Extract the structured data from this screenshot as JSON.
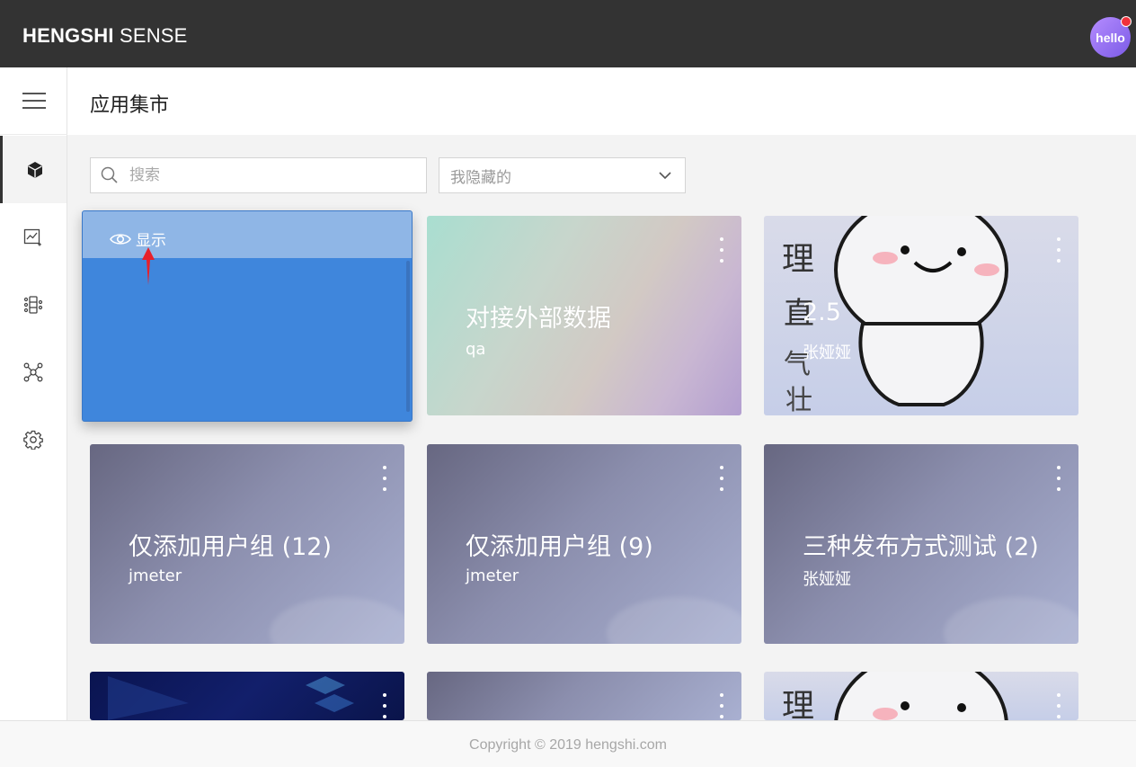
{
  "header": {
    "brand_bold": "HENGSHI",
    "brand_rest": " SENSE",
    "avatar_text": "hello",
    "notification_color": "#f0323c"
  },
  "sidebar": {
    "menu_icon": "hamburger-icon",
    "items": [
      {
        "icon": "cube-icon",
        "active": true
      },
      {
        "icon": "line-chart-icon",
        "active": false
      },
      {
        "icon": "dataset-icon",
        "active": false
      },
      {
        "icon": "network-icon",
        "active": false
      },
      {
        "icon": "gear-icon",
        "active": false
      }
    ]
  },
  "page": {
    "title": "应用集市"
  },
  "filters": {
    "search_placeholder": "搜索",
    "select_value": "我隐藏的"
  },
  "hidden_card": {
    "toggle_label": "显示"
  },
  "cards": [
    {
      "title": "对接外部数据",
      "subtitle": "qa",
      "style": "pastel"
    },
    {
      "title": "2.5",
      "subtitle": "张娅娅",
      "style": "sticker"
    },
    {
      "title": "仅添加用户组 (12)",
      "subtitle": "jmeter",
      "style": "purple"
    },
    {
      "title": "仅添加用户组 (9)",
      "subtitle": "jmeter",
      "style": "purple"
    },
    {
      "title": "三种发布方式测试 (2)",
      "subtitle": "张娅娅",
      "style": "purple"
    }
  ],
  "footer": {
    "copyright": "Copyright © 2019 hengshi.com"
  },
  "colors": {
    "topbar": "#333333",
    "hidden_card_blue": "#3f86dc",
    "annotation_arrow": "#e8202a"
  }
}
